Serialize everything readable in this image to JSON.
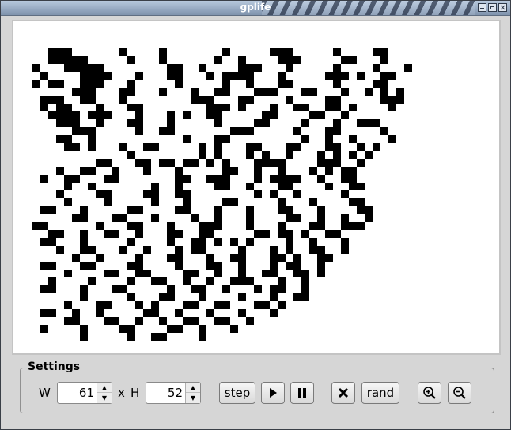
{
  "window": {
    "title": "gplife"
  },
  "settings": {
    "legend": "Settings",
    "width_label": "W",
    "width_value": "61",
    "times_label": "x",
    "height_label": "H",
    "height_value": "52"
  },
  "toolbar": {
    "step_label": "step",
    "rand_label": "rand",
    "icons": [
      "play-icon",
      "pause-icon",
      "clear-icon",
      "zoom-in-icon",
      "zoom-out-icon"
    ]
  },
  "board": {
    "cols": 61,
    "rows": 42,
    "rows_cells": [
      "",
      "",
      "",
      "    111      1    1       1     111     1    11",
      "    11111     1   1      1  1    111     11   1",
      "  1   11111        11  1    111   1     1    1   1",
      "   1    1111   1   11   1 1111   1     111 1  11",
      "  1 11  111   1     1     1  1   11     1    11",
      "       111   11   1   1  11   111   11   1  1 1 1",
      "   111  11   1        111   11    1    11     111",
      "   1 11   1   11        111 1   1  11  11 1    1",
      "    1111 111   1   1 1  11     11    11  1",
      "     111  1   11   1     1    11    1   1  111",
      "       111     1  11       111     1   11     1",
      "     11  1           1   11         1  1  1    1",
      "      11 1   1  11     1 1   11   11   11  1 1",
      "              1        1 1   1 1  1   1 1 1 1",
      "          11   11 11 11 1 1   1111    111  1",
      "     1  11  1   1   1     11  1  1   1 1 11",
      "   1  11   11       11  111   1 1111  1  11",
      "      1  1       1  1    11  1   11    1  11",
      "     1    11    11  11        1 1  1     1",
      "      1    1     1   1    11     1   1    11",
      "   11   1     11    11   1   1   11   1    11",
      "       11   11   1    1  1   1    11  1  1  1",
      "  11      1   11   1   111   1   1   11  111",
      "    11  1  11  1   11  11     11 11 1  11",
      "   11   1     1    1  11 1 1 1    1  1   1",
      "     1  11   1  1   1 11    1   1 1  11  1",
      "       1  1    1   11   1  11   11 1  11",
      "   11   11    11    1   11  1   1 11  1",
      "      1    11  11    11  1  1  11  11 1",
      "    1    1    1  11  1  1  111   1  1",
      "   11   1   11     1  11  1   1 11  1",
      "        1     1   11   1    1   1  11",
      "      1   11   1 1   11  11   11 1",
      "   11  1  1     11  1   1   1   1",
      "      11   11  1  1  11  11  1",
      "   1    1    11    11  1   1",
      "        1     1  11    1",
      "",
      ""
    ]
  }
}
